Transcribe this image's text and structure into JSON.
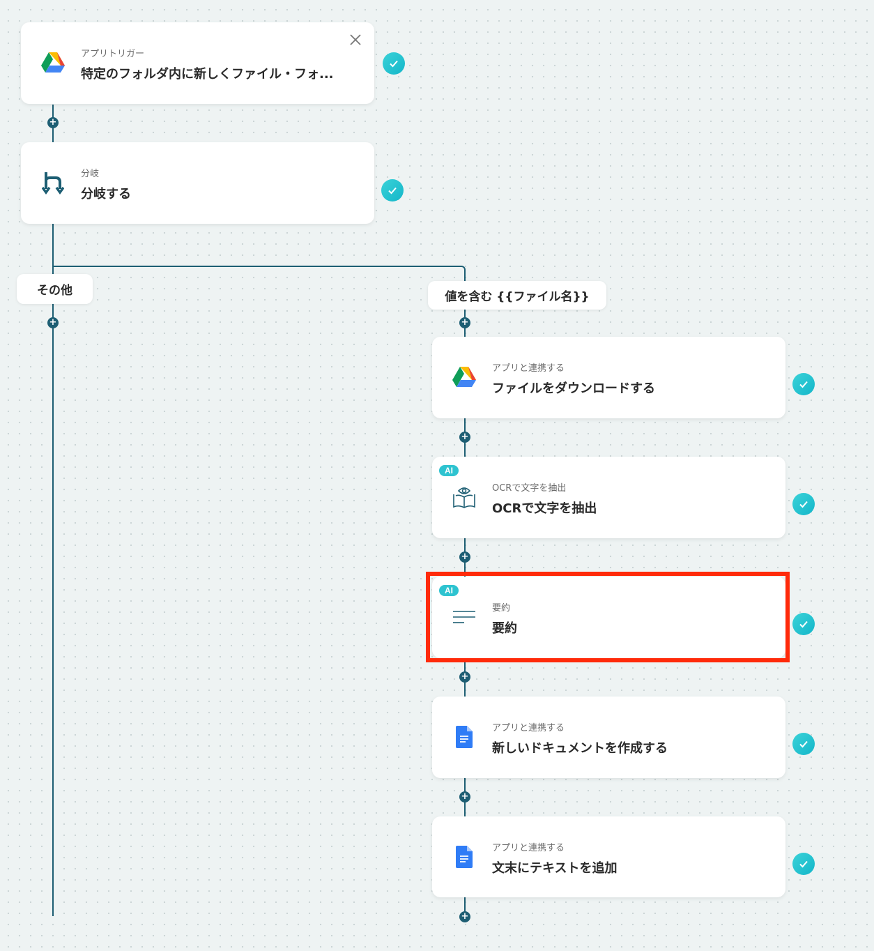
{
  "trigger": {
    "sub": "アプリトリガー",
    "title": "特定のフォルダ内に新しくファイル・フォ...",
    "icon": "google-drive-icon"
  },
  "branch": {
    "sub": "分岐",
    "title": "分岐する",
    "icon": "branch-icon"
  },
  "branch_labels": {
    "other": "その他",
    "condition": "値を含む {{ファイル名}}"
  },
  "steps": [
    {
      "sub": "アプリと連携する",
      "title": "ファイルをダウンロードする",
      "icon": "google-drive-icon"
    },
    {
      "badge": "AI",
      "sub": "OCRで文字を抽出",
      "title": "OCRで文字を抽出",
      "icon": "ocr-book-eye-icon"
    },
    {
      "badge": "AI",
      "sub": "要約",
      "title": "要約",
      "icon": "summary-lines-icon"
    },
    {
      "sub": "アプリと連携する",
      "title": "新しいドキュメントを作成する",
      "icon": "google-docs-icon"
    },
    {
      "sub": "アプリと連携する",
      "title": "文末にテキストを追加",
      "icon": "google-docs-icon"
    }
  ],
  "colors": {
    "connector": "#1d5e73",
    "check": "#14b6c9",
    "highlight": "#ff2a0a",
    "ai_badge": "#2ec3d0"
  }
}
